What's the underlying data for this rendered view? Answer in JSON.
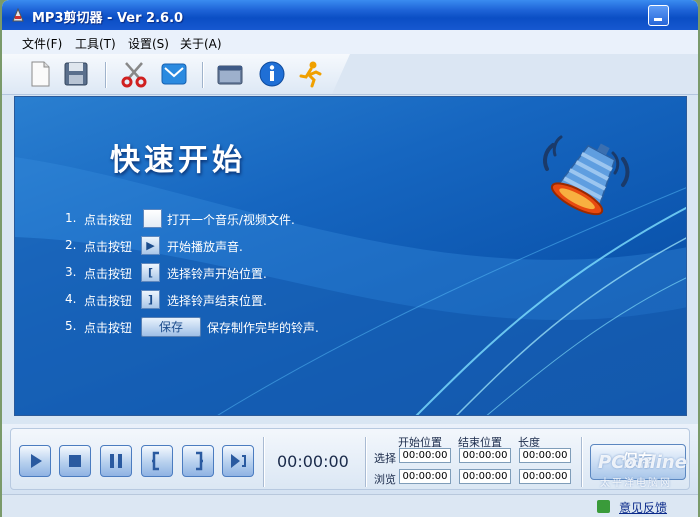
{
  "window": {
    "title": "MP3剪切器 - Ver 2.6.0"
  },
  "menu": [
    {
      "label": "文件(F)"
    },
    {
      "label": "工具(T)"
    },
    {
      "label": "设置(S)"
    },
    {
      "label": "关于(A)"
    }
  ],
  "toolbar": {
    "icons": [
      "new-file-icon",
      "save-icon",
      "scissors-icon",
      "mail-icon",
      "window-icon",
      "info-icon",
      "runner-icon"
    ]
  },
  "quickstart": {
    "title": "快速开始",
    "steps": [
      {
        "num": "1.",
        "pre": "点击按钮",
        "post": "打开一个音乐/视频文件."
      },
      {
        "num": "2.",
        "pre": "点击按钮",
        "post": "开始播放声音."
      },
      {
        "num": "3.",
        "pre": "点击按钮",
        "post": "选择铃声开始位置."
      },
      {
        "num": "4.",
        "pre": "点击按钮",
        "post": "选择铃声结束位置."
      },
      {
        "num": "5.",
        "pre": "点击按钮",
        "post": "保存制作完毕的铃声.",
        "button": "保存"
      }
    ]
  },
  "player": {
    "time": "00:00:00",
    "columns": [
      "开始位置",
      "结束位置",
      "长度"
    ],
    "rows": [
      {
        "label": "选择",
        "values": [
          "00:00:00",
          "00:00:00",
          "00:00:00"
        ]
      },
      {
        "label": "浏览",
        "values": [
          "00:00:00",
          "00:00:00",
          "00:00:00"
        ]
      }
    ],
    "save_label": "保存"
  },
  "status": {
    "feedback": "意见反馈"
  },
  "watermark": {
    "brand": "PConline",
    "sub": "太平洋电脑网"
  }
}
